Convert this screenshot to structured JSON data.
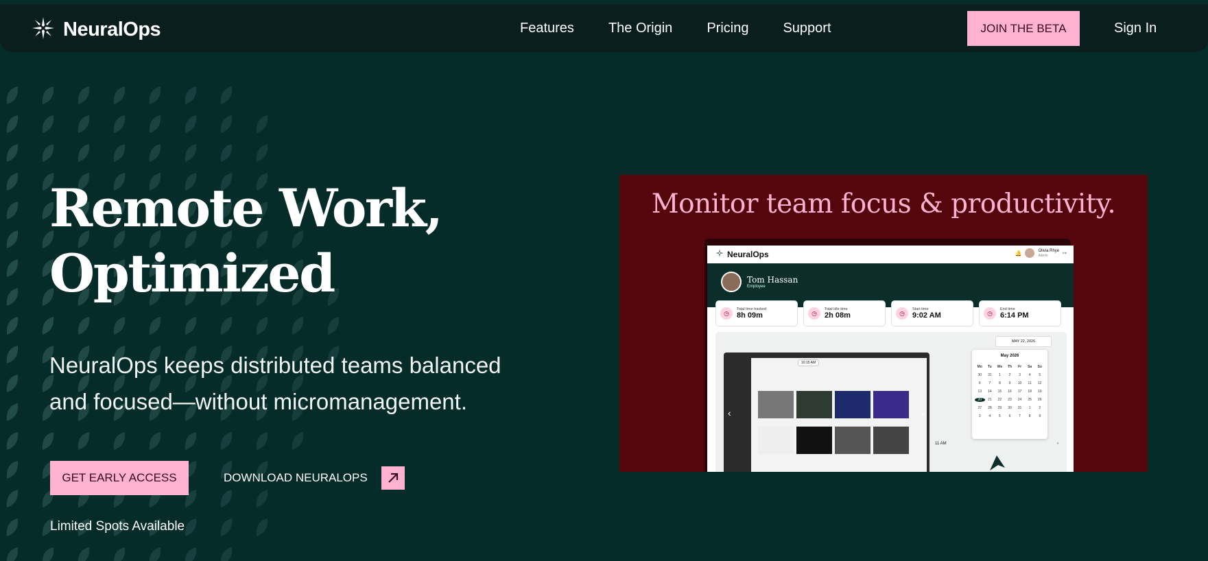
{
  "brand": {
    "name": "NeuralOps",
    "accent": "#ffb3d1",
    "background": "#062c2a",
    "nav_background": "#0a1e1d",
    "promo_background": "#55060c"
  },
  "nav": {
    "links": [
      "Features",
      "The Origin",
      "Pricing",
      "Support"
    ],
    "cta": "JOIN THE BETA",
    "signin": "Sign In"
  },
  "hero": {
    "title_line1": "Remote Work,",
    "title_line2": "Optimized",
    "subtitle_line1": "NeuralOps keeps distributed teams balanced",
    "subtitle_line2": "and focused—without micromanagement.",
    "primary_cta": "GET EARLY ACCESS",
    "secondary_cta": "DOWNLOAD NEURALOPS",
    "note": "Limited Spots Available"
  },
  "promo": {
    "title": "Monitor team focus & productivity.",
    "app": {
      "logo": "NeuralOps",
      "user_name": "Olivia Rhye",
      "user_role": "Admin",
      "employee_name": "Tom Hassan",
      "employee_role": "Employee",
      "stats": [
        {
          "label": "Total time tracked",
          "value": "8h 09m"
        },
        {
          "label": "Total idle time",
          "value": "2h 08m"
        },
        {
          "label": "Start time",
          "value": "9:02 AM"
        },
        {
          "label": "End time",
          "value": "6:14 PM"
        }
      ],
      "screenshot_time": "10:15 AM",
      "date": "MAY 22, 2026",
      "calendar": {
        "month": "May 2026",
        "weekdays": [
          "Mo",
          "Tu",
          "We",
          "Th",
          "Fr",
          "Sa",
          "Su"
        ],
        "days": [
          "30",
          "31",
          "1",
          "2",
          "3",
          "4",
          "5",
          "6",
          "7",
          "8",
          "9",
          "10",
          "11",
          "12",
          "13",
          "14",
          "15",
          "16",
          "17",
          "18",
          "19",
          "20",
          "21",
          "22",
          "23",
          "24",
          "25",
          "26",
          "27",
          "28",
          "29",
          "30",
          "31",
          "1",
          "2",
          "3",
          "4",
          "5",
          "6",
          "7",
          "8",
          "9"
        ],
        "selected": "20"
      },
      "time_slot": "11 AM"
    }
  }
}
